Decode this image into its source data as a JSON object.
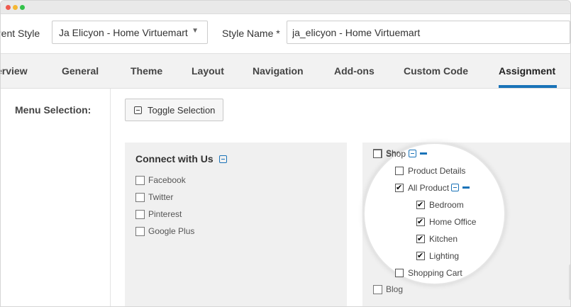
{
  "style_row": {
    "parent_style_label": "rent Style",
    "parent_style_value": "Ja Elicyon - Home Virtuemart",
    "style_name_label": "Style Name *",
    "style_name_value": "ja_elicyon - Home Virtuemart"
  },
  "tabs": [
    {
      "label": "erview"
    },
    {
      "label": "General"
    },
    {
      "label": "Theme"
    },
    {
      "label": "Layout"
    },
    {
      "label": "Navigation"
    },
    {
      "label": "Add-ons"
    },
    {
      "label": "Custom Code"
    },
    {
      "label": "Assignment",
      "active": true
    }
  ],
  "menu_selection": {
    "label": "Menu Selection:",
    "toggle_label": "Toggle Selection"
  },
  "left_group": {
    "title": "Connect with Us",
    "items": [
      {
        "label": "Facebook",
        "checked": false
      },
      {
        "label": "Twitter",
        "checked": false
      },
      {
        "label": "Pinterest",
        "checked": false
      },
      {
        "label": "Google Plus",
        "checked": false
      }
    ]
  },
  "right_group": {
    "shop": {
      "label": "Shop",
      "checked": false
    },
    "product_details": {
      "label": "Product Details",
      "checked": false
    },
    "all_product": {
      "label": "All Product",
      "checked": true
    },
    "children": [
      {
        "label": "Bedroom",
        "checked": true
      },
      {
        "label": "Home Office",
        "checked": true
      },
      {
        "label": "Kitchen",
        "checked": true
      },
      {
        "label": "Lighting",
        "checked": true
      }
    ],
    "shopping_cart": {
      "label": "Shopping Cart",
      "checked": false
    },
    "blog": {
      "label": "Blog",
      "checked": false
    }
  },
  "colors": {
    "accent": "#1a73b8"
  }
}
